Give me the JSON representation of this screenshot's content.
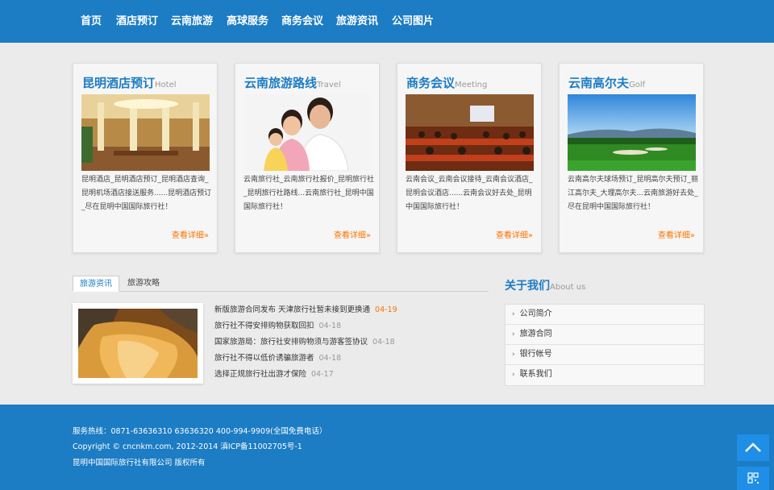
{
  "nav": {
    "items": [
      "首页",
      "酒店预订",
      "云南旅游",
      "高球服务",
      "商务会议",
      "旅游资讯",
      "公司图片"
    ]
  },
  "cards": [
    {
      "title_zh": "昆明酒店预订",
      "title_en": "Hotel",
      "desc": "昆明酒店_昆明酒店预订_昆明酒店查询_昆明机场酒店接送服务......昆明酒店预订_尽在昆明中国国际旅行社！",
      "more": "查看详细»"
    },
    {
      "title_zh": "云南旅游路线",
      "title_en": "Travel",
      "desc": "云南旅行社_云南旅行社报价_昆明旅行社_昆明旅行社路线...云南旅行社_昆明中国国际旅行社！",
      "more": "查看详细»"
    },
    {
      "title_zh": "商务会议",
      "title_en": "Meeting",
      "desc": "云南会议_云南会议接待_云南会议酒店_昆明会议酒店......云南会议好去处_昆明中国国际旅行社！",
      "more": "查看详细»"
    },
    {
      "title_zh": "云南高尔夫",
      "title_en": "Golf",
      "desc": "云南高尔夫球场预订_昆明高尔夫预订_丽江高尔夫_大理高尔夫...云南旅游好去处_尽在昆明中国国际旅行社！",
      "more": "查看详细»"
    }
  ],
  "news": {
    "tabs": [
      "旅游资讯",
      "旅游攻略"
    ],
    "items": [
      {
        "title": "新版旅游合同发布 天津旅行社暂未接到更换通",
        "date": "04-19"
      },
      {
        "title": "旅行社不得安排购物获取回扣",
        "date": "04-18"
      },
      {
        "title": "国家旅游局：旅行社安排购物须与游客签协议",
        "date": "04-18"
      },
      {
        "title": "旅行社不得以低价诱骗旅游者",
        "date": "04-18"
      },
      {
        "title": "选择正规旅行社出游才保险",
        "date": "04-17"
      }
    ]
  },
  "about": {
    "title_zh": "关于我们",
    "title_en": "About us",
    "items": [
      "公司简介",
      "旅游合同",
      "银行帐号",
      "联系我们"
    ]
  },
  "footer": {
    "hotline": "服务热线：0871-63636310 63636320   400-994-9909(全国免费电话）",
    "copyright": "Copyright © cncnkm.com, 2012-2014 滇ICP备11002705号-1",
    "company": "昆明中国国际旅行社有限公司 版权所有"
  },
  "colors": {
    "brand_blue": "#1c7cc4",
    "accent_orange": "#ff7200"
  },
  "icons": {
    "more_arrow": "chevron-right-icon",
    "back_to_top": "chevron-up-icon",
    "qr": "qr-code-icon"
  }
}
